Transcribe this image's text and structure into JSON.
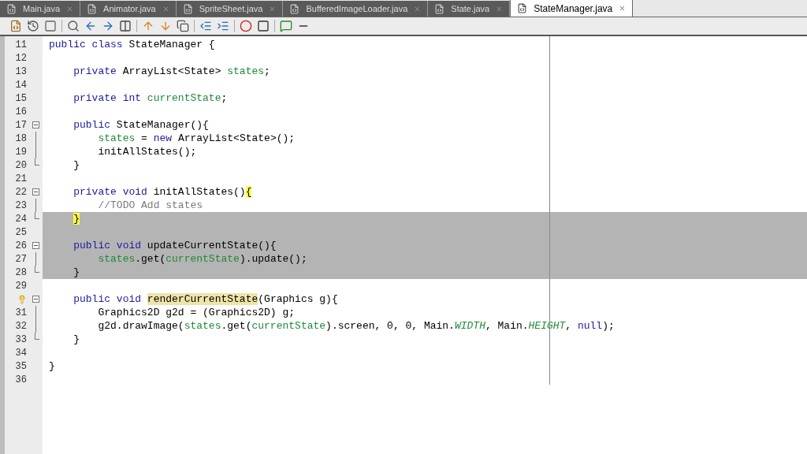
{
  "tabs": [
    {
      "label": "Main.java",
      "selected": false
    },
    {
      "label": "Animator.java",
      "selected": false
    },
    {
      "label": "SpriteSheet.java",
      "selected": false
    },
    {
      "label": "BufferedImageLoader.java",
      "selected": false
    },
    {
      "label": "State.java",
      "selected": false
    },
    {
      "label": "StateManager.java",
      "selected": true
    }
  ],
  "toolbar": [
    {
      "kind": "source"
    },
    {
      "kind": "history"
    },
    {
      "kind": "back"
    },
    {
      "kind": "sep"
    },
    {
      "kind": "find"
    },
    {
      "kind": "prev"
    },
    {
      "kind": "next"
    },
    {
      "kind": "toggle"
    },
    {
      "kind": "sep"
    },
    {
      "kind": "up"
    },
    {
      "kind": "down"
    },
    {
      "kind": "copy"
    },
    {
      "kind": "sep"
    },
    {
      "kind": "shift-left"
    },
    {
      "kind": "shift-right"
    },
    {
      "kind": "sep"
    },
    {
      "kind": "record"
    },
    {
      "kind": "stop"
    },
    {
      "kind": "sep"
    },
    {
      "kind": "comment"
    },
    {
      "kind": "uncomment"
    }
  ],
  "lines": [
    {
      "number": "11",
      "dragged": false,
      "tokens": [
        {
          "text": "public class ",
          "kind": "kw"
        },
        {
          "text": "StateManager {",
          "kind": "plain"
        }
      ]
    },
    {
      "number": "12",
      "dragged": false
    },
    {
      "number": "13",
      "dragged": false,
      "tokens": [
        {
          "text": "    private ",
          "kind": "kw"
        },
        {
          "text": "ArrayList<State> ",
          "kind": "plain"
        },
        {
          "text": "states",
          "kind": "field"
        },
        {
          "text": ";",
          "kind": "plain"
        }
      ]
    },
    {
      "number": "14",
      "dragged": false
    },
    {
      "number": "15",
      "dragged": false,
      "tokens": [
        {
          "text": "    private int ",
          "kind": "kw"
        },
        {
          "text": "currentState",
          "kind": "field"
        },
        {
          "text": ";",
          "kind": "plain"
        }
      ]
    },
    {
      "number": "16",
      "dragged": false
    },
    {
      "number": "17",
      "fold": {
        "kind": "start"
      },
      "dragged": false,
      "tokens": [
        {
          "text": "    public ",
          "kind": "kw"
        },
        {
          "text": "StateManager(){",
          "kind": "plain"
        }
      ]
    },
    {
      "number": "18",
      "fold": {
        "kind": "line"
      },
      "dragged": false,
      "tokens": [
        {
          "text": "        states",
          "kind": "field"
        },
        {
          "text": " = ",
          "kind": "plain"
        },
        {
          "text": "new ",
          "kind": "kw"
        },
        {
          "text": "ArrayList<State>();",
          "kind": "plain"
        }
      ]
    },
    {
      "number": "19",
      "fold": {
        "kind": "line"
      },
      "dragged": false,
      "tokens": [
        {
          "text": "        initAllStates();",
          "kind": "plain"
        }
      ]
    },
    {
      "number": "20",
      "fold": {
        "kind": "end"
      },
      "dragged": false,
      "tokens": [
        {
          "text": "    }",
          "kind": "plain"
        }
      ]
    },
    {
      "number": "21",
      "dragged": false
    },
    {
      "number": "22",
      "fold": {
        "kind": "start"
      },
      "dragged": false,
      "tokens": [
        {
          "text": "    private void ",
          "kind": "kw"
        },
        {
          "text": "initAllStates()",
          "kind": "plain"
        },
        {
          "text": "{",
          "kind": "match"
        }
      ]
    },
    {
      "number": "23",
      "fold": {
        "kind": "line"
      },
      "dragged": false,
      "tokens": [
        {
          "text": "        //TODO Add states",
          "kind": "comment"
        }
      ]
    },
    {
      "number": "24",
      "fold": {
        "kind": "end"
      },
      "dragged": true,
      "tokens": [
        {
          "text": "    }",
          "kind": "match"
        }
      ]
    },
    {
      "number": "25",
      "dragged": true
    },
    {
      "number": "26",
      "fold": {
        "kind": "start"
      },
      "dragged": true,
      "tokens": [
        {
          "text": "    public void ",
          "kind": "kw"
        },
        {
          "text": "updateCurrentState(){",
          "kind": "plain"
        }
      ]
    },
    {
      "number": "27",
      "fold": {
        "kind": "line"
      },
      "dragged": true,
      "tokens": [
        {
          "text": "        states",
          "kind": "field"
        },
        {
          "text": ".get(",
          "kind": "plain"
        },
        {
          "text": "currentState",
          "kind": "field"
        },
        {
          "text": ").update();",
          "kind": "plain"
        }
      ]
    },
    {
      "number": "28",
      "fold": {
        "kind": "end"
      },
      "dragged": true,
      "tokens": [
        {
          "text": "    }",
          "kind": "plain"
        }
      ]
    },
    {
      "number": "29",
      "dragged": false
    },
    {
      "hint": true,
      "fold": {
        "kind": "start"
      },
      "dragged": false,
      "tokens": [
        {
          "text": "    public void ",
          "kind": "kw"
        },
        {
          "text": "renderCurrentState",
          "kind": "mark"
        },
        {
          "text": "(Graphics g){",
          "kind": "plain"
        }
      ]
    },
    {
      "number": "31",
      "fold": {
        "kind": "line"
      },
      "dragged": false,
      "tokens": [
        {
          "text": "        Graphics2D g2d = (Graphics2D) g;",
          "kind": "plain"
        }
      ]
    },
    {
      "number": "32",
      "fold": {
        "kind": "line"
      },
      "dragged": false,
      "tokens": [
        {
          "text": "        g2d.drawImage(",
          "kind": "plain"
        },
        {
          "text": "states",
          "kind": "field"
        },
        {
          "text": ".get(",
          "kind": "plain"
        },
        {
          "text": "currentState",
          "kind": "field"
        },
        {
          "text": ").screen, 0, 0, Main.",
          "kind": "plain"
        },
        {
          "text": "WIDTH",
          "kind": "static"
        },
        {
          "text": ", Main.",
          "kind": "plain"
        },
        {
          "text": "HEIGHT",
          "kind": "static"
        },
        {
          "text": ", ",
          "kind": "plain"
        },
        {
          "text": "null",
          "kind": "kw"
        },
        {
          "text": ");",
          "kind": "plain"
        }
      ]
    },
    {
      "number": "33",
      "fold": {
        "kind": "end"
      },
      "dragged": false,
      "tokens": [
        {
          "text": "    }",
          "kind": "plain"
        }
      ]
    },
    {
      "number": "34",
      "dragged": false
    },
    {
      "number": "35",
      "dragged": false,
      "tokens": [
        {
          "text": "}",
          "kind": "plain"
        }
      ]
    },
    {
      "number": "36",
      "dragged": false
    }
  ]
}
